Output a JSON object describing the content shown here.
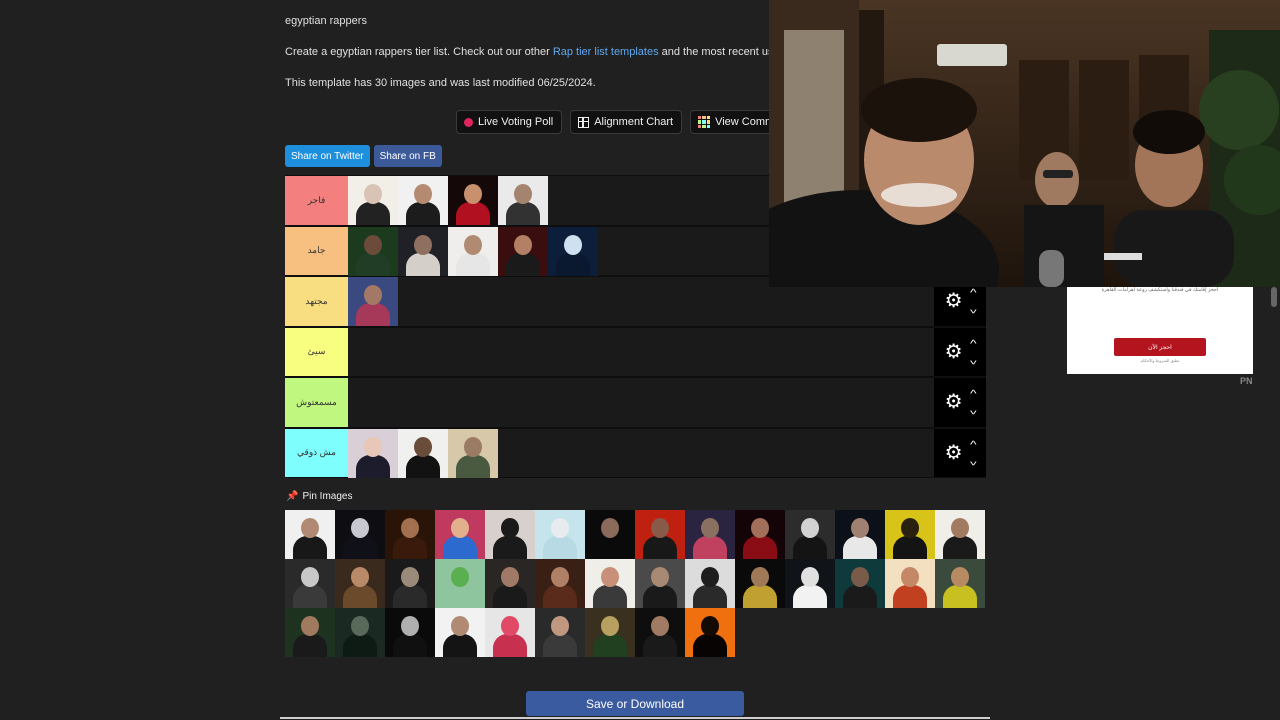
{
  "page": {
    "title": "egyptian rappers",
    "intro_prefix": "Create a egyptian rappers tier list. Check out our other ",
    "intro_link": "Rap tier list templates",
    "intro_suffix": " and the most recent user",
    "meta": "This template has 30 images and was last modified 06/25/2024."
  },
  "tools": [
    {
      "label": "Live Voting Poll",
      "icon": "red-dot-icon"
    },
    {
      "label": "Alignment Chart",
      "icon": "grid-icon"
    },
    {
      "label": "View Commun",
      "icon": "community-icon"
    }
  ],
  "share": {
    "twitter": "Share on Twitter",
    "facebook": "Share on FB"
  },
  "tiers": [
    {
      "label": "فاجر",
      "color": "#f47f7f"
    },
    {
      "label": "جامد",
      "color": "#f7bf80"
    },
    {
      "label": "مجتهد",
      "color": "#f8de80"
    },
    {
      "label": "سيئ",
      "color": "#f8fe80"
    },
    {
      "label": "مسمعتوش",
      "color": "#c0f87f"
    },
    {
      "label": "مش ذوقي",
      "color": "#7efffe"
    }
  ],
  "pin_label": "Pin Images",
  "save_label": "Save or Download",
  "ad": {
    "top_text": "احجز إقامتك في فندقنا واستكشف روعة اهرامات القاهرة",
    "button": "احجز الآن",
    "sub_text": "تطبق الشروط والأحكام",
    "tag": "PN"
  },
  "colors": {
    "background": "#202020",
    "link": "#5fa8f0",
    "save": "#3b5ba0"
  }
}
